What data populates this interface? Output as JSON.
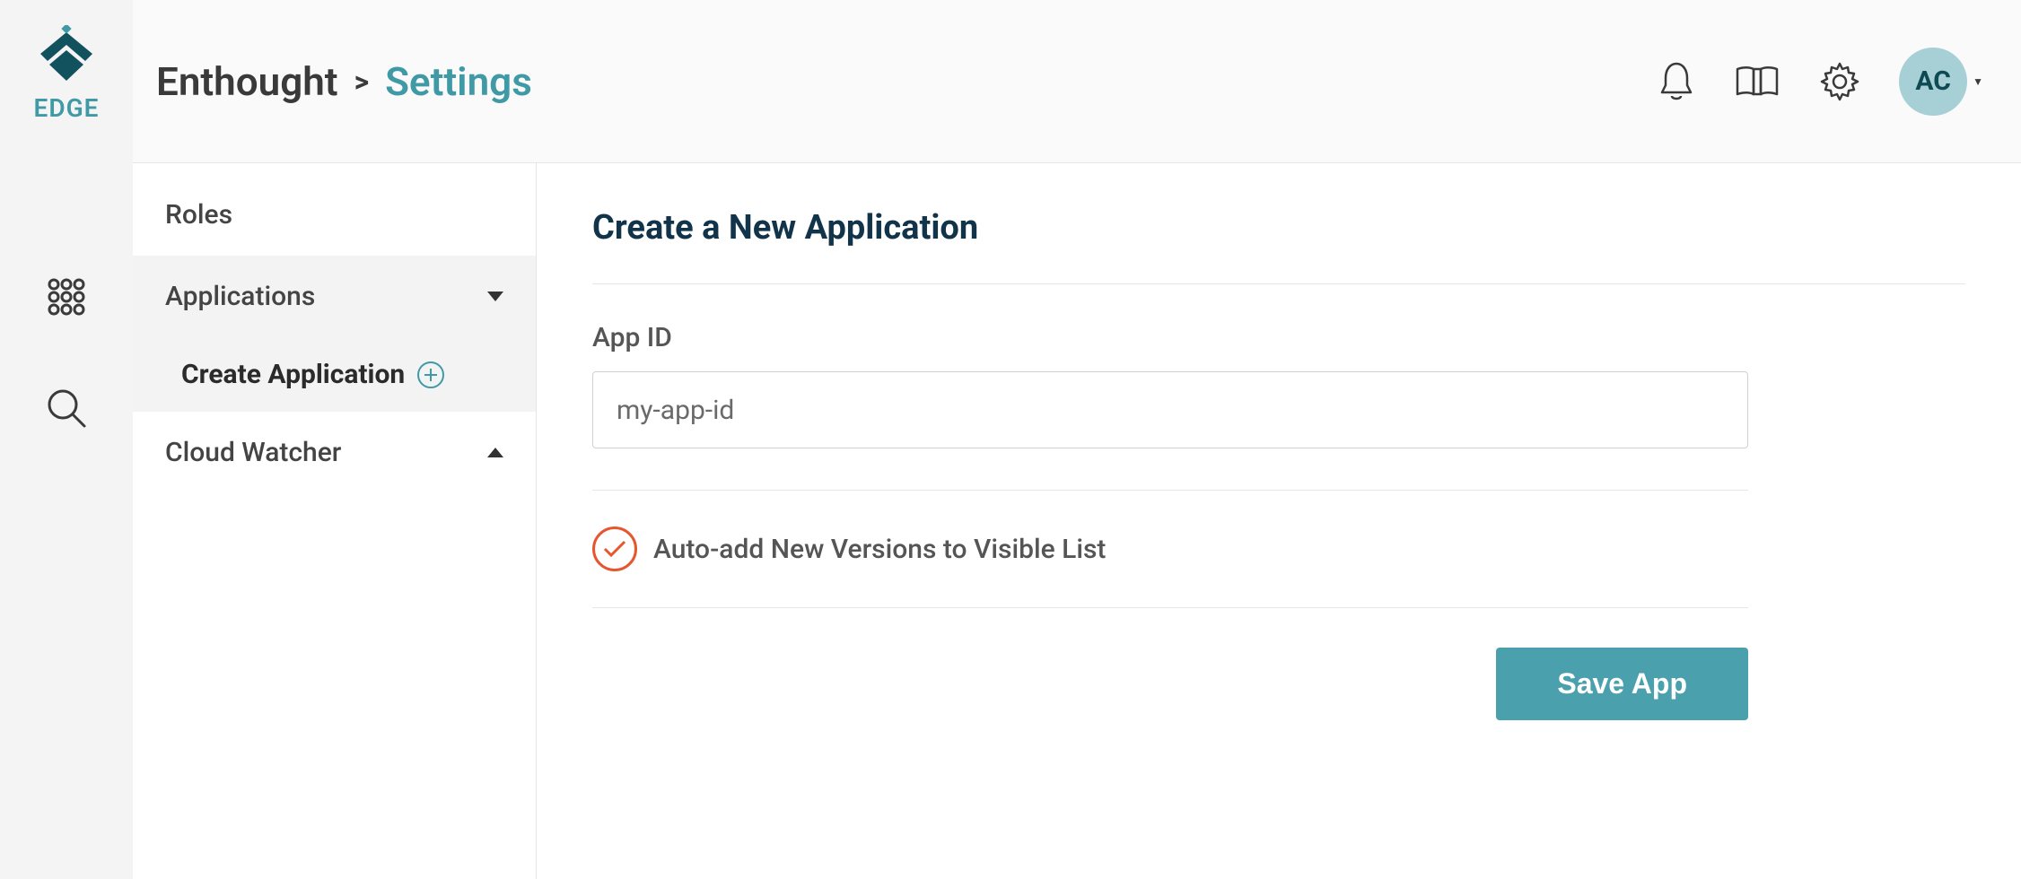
{
  "brand": {
    "name": "EDGE"
  },
  "header": {
    "breadcrumb_org": "Enthought",
    "breadcrumb_sep": ">",
    "breadcrumb_page": "Settings",
    "avatar_initials": "AC"
  },
  "sidebar": {
    "roles": "Roles",
    "applications": "Applications",
    "create_application": "Create Application",
    "cloud_watcher": "Cloud Watcher"
  },
  "form": {
    "title": "Create a New Application",
    "app_id_label": "App ID",
    "app_id_value": "my-app-id",
    "auto_add_label": "Auto-add New Versions to Visible List",
    "save_label": "Save App"
  }
}
